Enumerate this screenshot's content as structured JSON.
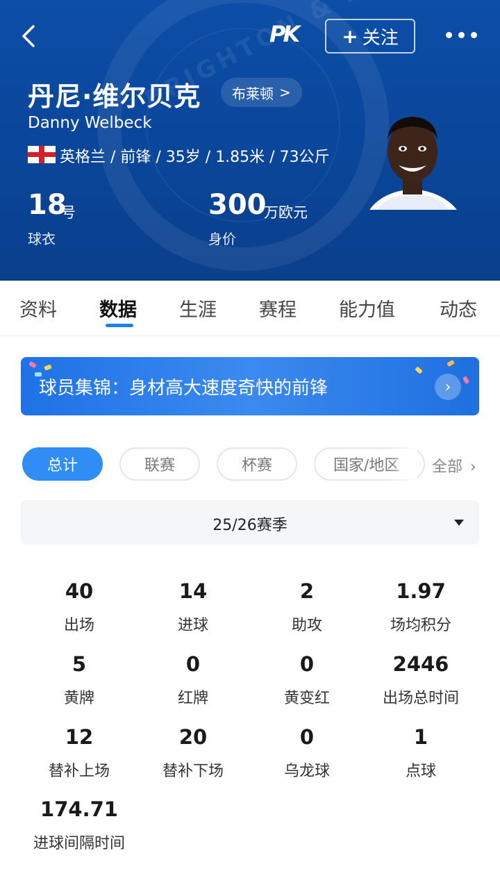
{
  "header": {
    "follow_label": "关注",
    "logo_text": "PK",
    "name_cn": "丹尼·维尔贝克",
    "team": "布莱顿",
    "name_en": "Danny Welbeck",
    "bio": "英格兰 / 前锋 / 35岁 / 1.85米 / 73公斤",
    "crest_text": "BRIGHTON & HOVE",
    "jersey_number": "18",
    "jersey_unit": "号",
    "jersey_caption": "球衣",
    "market_value": "300",
    "market_unit": "万欧元",
    "market_caption": "身价"
  },
  "tabs": [
    "资料",
    "数据",
    "生涯",
    "赛程",
    "能力值",
    "动态"
  ],
  "banner": {
    "text": "球员集锦：身材高大速度奇快的前锋"
  },
  "filters": [
    "总计",
    "联赛",
    "杯赛",
    "国家/地区"
  ],
  "filter_all": "全部",
  "season": "25/26赛季",
  "stats": [
    {
      "value": "40",
      "label": "出场"
    },
    {
      "value": "14",
      "label": "进球"
    },
    {
      "value": "2",
      "label": "助攻"
    },
    {
      "value": "1.97",
      "label": "场均积分"
    },
    {
      "value": "5",
      "label": "黄牌"
    },
    {
      "value": "0",
      "label": "红牌"
    },
    {
      "value": "0",
      "label": "黄变红"
    },
    {
      "value": "2446",
      "label": "出场总时间"
    },
    {
      "value": "12",
      "label": "替补上场"
    },
    {
      "value": "20",
      "label": "替补下场"
    },
    {
      "value": "0",
      "label": "乌龙球"
    },
    {
      "value": "1",
      "label": "点球"
    },
    {
      "value": "174.71",
      "label": "进球间隔时间"
    }
  ],
  "colors": {
    "header_blue": "#0c4ea8",
    "accent_blue": "#2f8df3",
    "tab_indicator": "#1f7ff0"
  }
}
